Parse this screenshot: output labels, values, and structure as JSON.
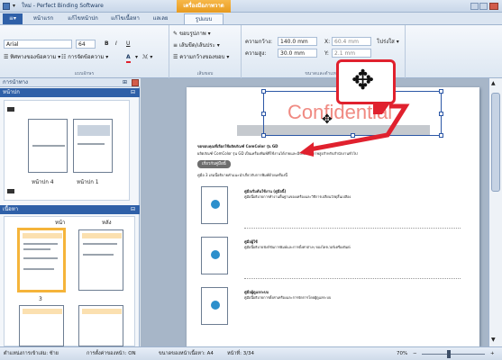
{
  "window": {
    "title": "ใหม่ - Perfect Binding Software",
    "context_tab": "เครื่องมือภาพวาด",
    "min_icon": "minimize-icon",
    "max_icon": "maximize-icon",
    "close_icon": "close-icon"
  },
  "tabs": [
    "หน้าแรก",
    "แก้ไขหน้าปก",
    "แก้ไขเนื้อหา",
    "แลเลย",
    "รูปแบบ"
  ],
  "ribbon": {
    "font_name": "Arial",
    "font_size": "64",
    "bold": "B",
    "italic": "I",
    "underline": "U",
    "align_label": "ทิศทางของข้อความ",
    "spacing_label": "การจัดข้อความ",
    "font_color_glyph": "A",
    "group_font": "แบบอักษร",
    "outline_label": "ขอบรูปภาพ",
    "line_label": "เส้นขีด/เส้นประ",
    "shape_label": "ความกว้างของขอบ",
    "group_style": "เส้นขอบ",
    "width_label": "ความกว้าง:",
    "width_value": "140.0 mm",
    "height_label": "ความสูง:",
    "height_value": "30.0 mm",
    "x_label": "X:",
    "x_value": "60.4 mm",
    "y_label": "Y:",
    "y_value": "2.1 mm",
    "opacity_label": "โปร่งใส",
    "group_size": "ขนาดและตำแหน่ง"
  },
  "pane": {
    "header1": "การนำทาง",
    "header2": "หน้าปก",
    "cover_labels": [
      "หน้าปก 4",
      "หน้าปก 1"
    ],
    "header3": "เนื้อหา",
    "col_page": "หน้า",
    "col_back": "หลัง",
    "page_number": "3"
  },
  "document": {
    "watermark": "Confidential",
    "intro1": "ขอขอบคุณที่เลือกใช้ผลิตภัณฑ์ ComColor รุ่น GD",
    "intro2": "ผลิตภัณฑ์ ComColor รุ่น GD เป็นเครื่องพิมพ์ที่ใช้งานได้ง่ายและมีประสิทธิภาพสูงสำหรับสำนักงานทั่วไป",
    "section_title": "เกี่ยวกับคู่มือนี้",
    "section_sub": "คู่มือ 3 เล่มนี้อธิบายคำแนะนำเกี่ยวกับการพิมพ์ด้วยเครื่องนี้",
    "items": [
      {
        "title": "คู่มือเริ่มต้นใช้งาน (คู่มือนี้)",
        "text": "คู่มือนี้อธิบายการทำงานพื้นฐานของเครื่องและวิธีการเปลี่ยนวัสดุสิ้นเปลือง"
      },
      {
        "title": "คู่มือผู้ใช้",
        "text": "คู่มือนี้อธิบายฟังก์ชันการพิมพ์และการตั้งค่าต่างๆ ของไดรเวอร์เครื่องพิมพ์"
      },
      {
        "title": "คู่มือผู้ดูแลระบบ",
        "text": "คู่มือนี้อธิบายการตั้งค่าเครื่องและการจัดการโดยผู้ดูแลระบบ"
      }
    ]
  },
  "callout": {
    "icon": "move-arrows-icon"
  },
  "status": {
    "page_direction": "ตำแหน่งการเข้าเล่ม: ซ้าย",
    "crop_marks": "การตั้งค่าของหน้า: ON",
    "page_size": "ขนาดของหน้าเนื้อหา: A4",
    "page_index": "หน้าที่: 3/34",
    "zoom": "70%",
    "zoom_out": "−",
    "zoom_in": "+"
  },
  "colors": {
    "accent": "#2f60a8",
    "context": "#f0a83a",
    "callout_red": "#e0212e"
  }
}
